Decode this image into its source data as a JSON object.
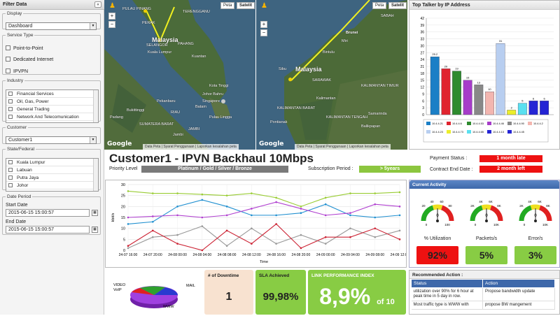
{
  "sidebar": {
    "title": "Filter Data",
    "collapse": "«",
    "display": {
      "legend": "Display",
      "value": "Dashboard"
    },
    "service_type": {
      "legend": "Service Type",
      "options": [
        "Point-to-Point",
        "Dedicated Internet",
        "IPVPN"
      ]
    },
    "industry": {
      "legend": "Industry",
      "items": [
        "Financial Services",
        "Oil, Gas, Power",
        "General Trading",
        "Network And Telecomunication"
      ]
    },
    "customer": {
      "legend": "Customer",
      "value": "Customer1"
    },
    "state": {
      "legend": "State/Federal",
      "items": [
        "Kuala Lumpur",
        "Labuan",
        "Putra Jaya",
        "Johor"
      ]
    },
    "date_period": {
      "legend": "Date Period",
      "start_label": "Start Date",
      "start_value": "2015-06-15 15:00:57",
      "end_label": "End Date",
      "end_value": "2015-06-15 15:00:57"
    }
  },
  "maps": {
    "map_btn": "Peta",
    "sat_btn": "Satelit",
    "google": "Google",
    "footer": [
      "Data Peta",
      "Syarat Penggunaan",
      "Laporkan kesalahan peta"
    ],
    "left_labels": [
      "PULAU PINANG",
      "PERAK",
      "Malaysia",
      "Kuala Lumpur",
      "SELANGOR",
      "PAHANG",
      "Kota Tinggi",
      "Johor Bahru",
      "TERENGGANU",
      "Kuantan",
      "Batam",
      "Singapore",
      "Pekanbaru",
      "Padang",
      "Jambi",
      "Bukittinggi",
      "RIAU",
      "JAMBI",
      "SUMATERA BARAT",
      "Pulau Lingga"
    ],
    "right_labels": [
      "SABAH",
      "Brunei",
      "Miri",
      "Bintulu",
      "Malaysia",
      "Sibu",
      "SARAWAK",
      "Kalimantan",
      "KALIMANTAN BARAT",
      "KALIMANTAN TENGAH",
      "KALIMANTAN TIMUR",
      "Pontianak",
      "Samarinda",
      "Balikpapan"
    ]
  },
  "header": {
    "customer_title": "Customer1 - IPVN Backhaul 10Mbps",
    "priority_label": "Priority Level",
    "priority_value": "Platinum / Gold / Silver / Bronze",
    "subscription_label": "Subscription Period :",
    "subscription_value": "> 5years",
    "payment_label": "Payment Status :",
    "payment_value": "1 month late",
    "contract_label": "Contract End Date :",
    "contract_value": "2 month left"
  },
  "talker": {
    "title": "Top Talker by IP Address",
    "chart_data": {
      "type": "bar",
      "ylim": [
        0,
        42
      ],
      "yticks": [
        0,
        3,
        6,
        9,
        12,
        15,
        18,
        21,
        24,
        27,
        30,
        33,
        36,
        39,
        42
      ],
      "categories": [
        "10.4.4.21",
        "10.4.4.6",
        "10.4.4.53",
        "10.4.4.46",
        "10.4.4.90",
        "10.4.4.2",
        "10.4.4.23",
        "10.4.4.73",
        "10.4.4.65",
        "10.4.4.13",
        "10.4.4.45"
      ],
      "values": [
        25.2,
        20,
        19,
        15,
        13,
        10,
        31,
        2,
        5,
        6,
        6
      ],
      "data_labels": [
        "25.2",
        "20",
        "19",
        "15",
        "13",
        "10",
        "31",
        "2",
        "5",
        "6",
        "6"
      ],
      "colors": [
        "#1b7fc6",
        "#e0242f",
        "#2e8b2e",
        "#a63cc9",
        "#888888",
        "#f3b6b0",
        "#b8cef0",
        "#ecee2a",
        "#5ae0f0",
        "#2424d4",
        "#2424d4"
      ],
      "legend_order": [
        0,
        1,
        2,
        3,
        4,
        5,
        6,
        7,
        8,
        9,
        10
      ]
    }
  },
  "line_chart": {
    "chart_data": {
      "type": "line",
      "ylabel": "kbit/s",
      "xlabel": "Time",
      "ylim": [
        0,
        30
      ],
      "yticks": [
        0,
        5,
        10,
        15,
        20,
        25,
        30
      ],
      "x": [
        "24-07 16:00",
        "24-07 20:00",
        "24-08 00:00",
        "24-08 04:00",
        "24-08 08:00",
        "24-08 12:00",
        "24-08 16:00",
        "24-08 20:00",
        "24-09 00:00",
        "24-09 04:00",
        "24-09 08:00",
        "24-09 12:00"
      ],
      "series": [
        {
          "color": "#99cc33",
          "values": [
            27,
            26,
            26,
            25.5,
            25,
            26,
            24,
            20,
            24,
            26,
            26,
            26.5
          ]
        },
        {
          "color": "#1f8fd0",
          "values": [
            12,
            13,
            20,
            23,
            20,
            16,
            16,
            17,
            21,
            16,
            15,
            16
          ]
        },
        {
          "color": "#b040d0",
          "values": [
            15,
            15.5,
            16,
            15,
            16,
            19,
            22,
            19,
            16,
            17,
            21,
            20
          ]
        },
        {
          "color": "#999999",
          "values": [
            1,
            6,
            7,
            11,
            2,
            10,
            3,
            7,
            3,
            10,
            6,
            9
          ]
        },
        {
          "color": "#cc2233",
          "values": [
            2,
            9,
            3,
            0,
            9,
            3,
            12,
            1,
            6,
            6,
            10,
            5
          ]
        }
      ]
    }
  },
  "activity": {
    "title": "Current Activity",
    "gauges": [
      {
        "name": "% Utilization",
        "value": "92%",
        "color": "#ee1111",
        "ticks": [
          "20",
          "40",
          "60",
          "80",
          "0",
          "100"
        ]
      },
      {
        "name": "Packets/s",
        "value": "5%",
        "color": "#88cc44",
        "ticks": [
          "2K",
          "4K",
          "6K",
          "8K",
          "0",
          "10K"
        ]
      },
      {
        "name": "Error/s",
        "value": "3%",
        "color": "#88cc44",
        "ticks": [
          "2K",
          "4K",
          "6K",
          "8K",
          "0",
          "10K"
        ]
      }
    ],
    "gauge_readout": "0"
  },
  "pie": {
    "labels": [
      "VIDEO",
      "VoIP",
      "MAIL",
      "WWW"
    ],
    "chart_data": {
      "type": "pie",
      "categories": [
        "WWW",
        "MAIL",
        "VIDEO",
        "VoIP"
      ],
      "values": [
        55,
        25,
        12,
        8
      ],
      "colors": [
        "#a040e0",
        "#2a3ad0",
        "#2ea02e",
        "#e02020"
      ]
    }
  },
  "tiles": {
    "downtime": {
      "title": "# of Downtime",
      "value": "1"
    },
    "sla": {
      "title": "SLA Achieved",
      "value": "99,98%"
    },
    "lpi": {
      "title": "LINK PERFORMANCE INDEX",
      "value": "8,9%",
      "suffix": "of 10"
    }
  },
  "recommend": {
    "title": "Recommended Action :",
    "headers": [
      "Status",
      "Action"
    ],
    "rows": [
      [
        "utilization over 90% for 6 hour at peak time in 5 day in row.",
        "Propose bandwidth update"
      ],
      [
        "Most traffic type is WWW with",
        "propose BW mangement"
      ]
    ]
  }
}
